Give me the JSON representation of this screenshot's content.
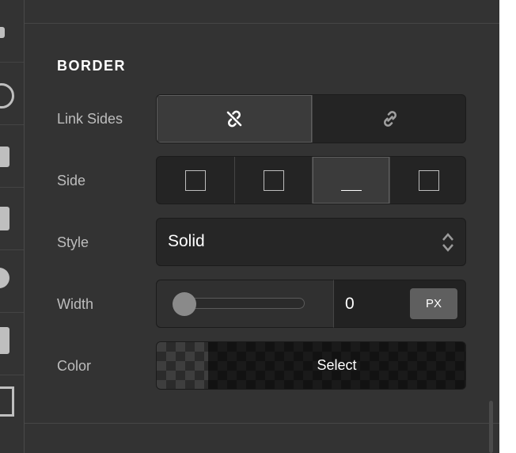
{
  "section": {
    "title": "BORDER"
  },
  "labels": {
    "link_sides": "Link Sides",
    "side": "Side",
    "style": "Style",
    "width": "Width",
    "color": "Color"
  },
  "link_sides": {
    "options": [
      "unlinked",
      "linked"
    ],
    "selected": "unlinked",
    "icons": {
      "unlinked": "unlink-icon",
      "linked": "link-icon"
    }
  },
  "side": {
    "options": [
      "top",
      "right",
      "bottom",
      "left"
    ],
    "selected": "bottom"
  },
  "style_select": {
    "value": "Solid"
  },
  "width": {
    "value": "0",
    "unit": "PX",
    "slider_fraction": 0.0
  },
  "color": {
    "button_label": "Select"
  },
  "colors": {
    "panel_bg": "#333333",
    "control_bg": "#242424",
    "accent_text": "#ffffff"
  }
}
